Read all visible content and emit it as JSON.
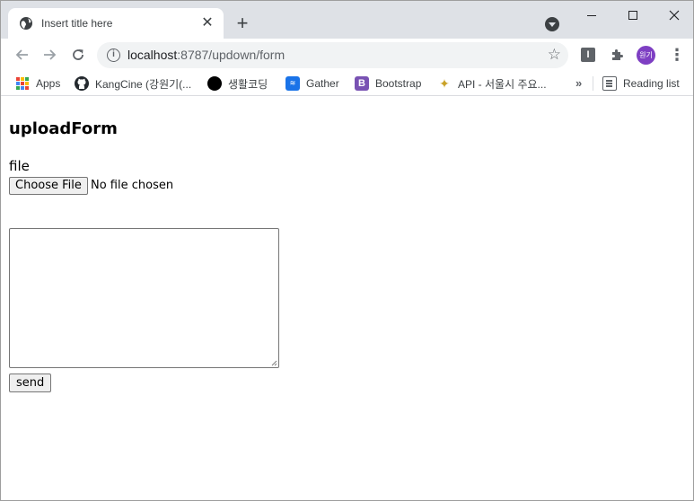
{
  "browser": {
    "tab": {
      "title": "Insert title here",
      "close_glyph": "✕"
    },
    "new_tab_glyph": "+",
    "url": {
      "host": "localhost",
      "rest": ":8787/updown/form"
    },
    "avatar_text": "원기",
    "ext_letter": "I"
  },
  "bookmarks": {
    "items": [
      {
        "label": "Apps",
        "icon": "apps-grid-icon"
      },
      {
        "label": "KangCine (강원기(...",
        "icon": "github-icon"
      },
      {
        "label": "생활코딩",
        "icon": "black-dot-icon"
      },
      {
        "label": "Gather",
        "icon": "gather-icon",
        "icon_text": "≋"
      },
      {
        "label": "Bootstrap",
        "icon": "bootstrap-icon",
        "icon_text": "B"
      },
      {
        "label": "API - 서울시 주요...",
        "icon": "api-icon"
      }
    ],
    "overflow_glyph": "»",
    "reading_list": "Reading list"
  },
  "page": {
    "heading": "uploadForm",
    "file_label": "file",
    "choose_file": "Choose File",
    "no_file": "No file chosen",
    "send": "send"
  },
  "colors": {
    "avatar": "#7e3fc3",
    "bootstrap": "#7952b3",
    "gather": "#1a73e8",
    "tabstrip": "#dee1e6"
  }
}
